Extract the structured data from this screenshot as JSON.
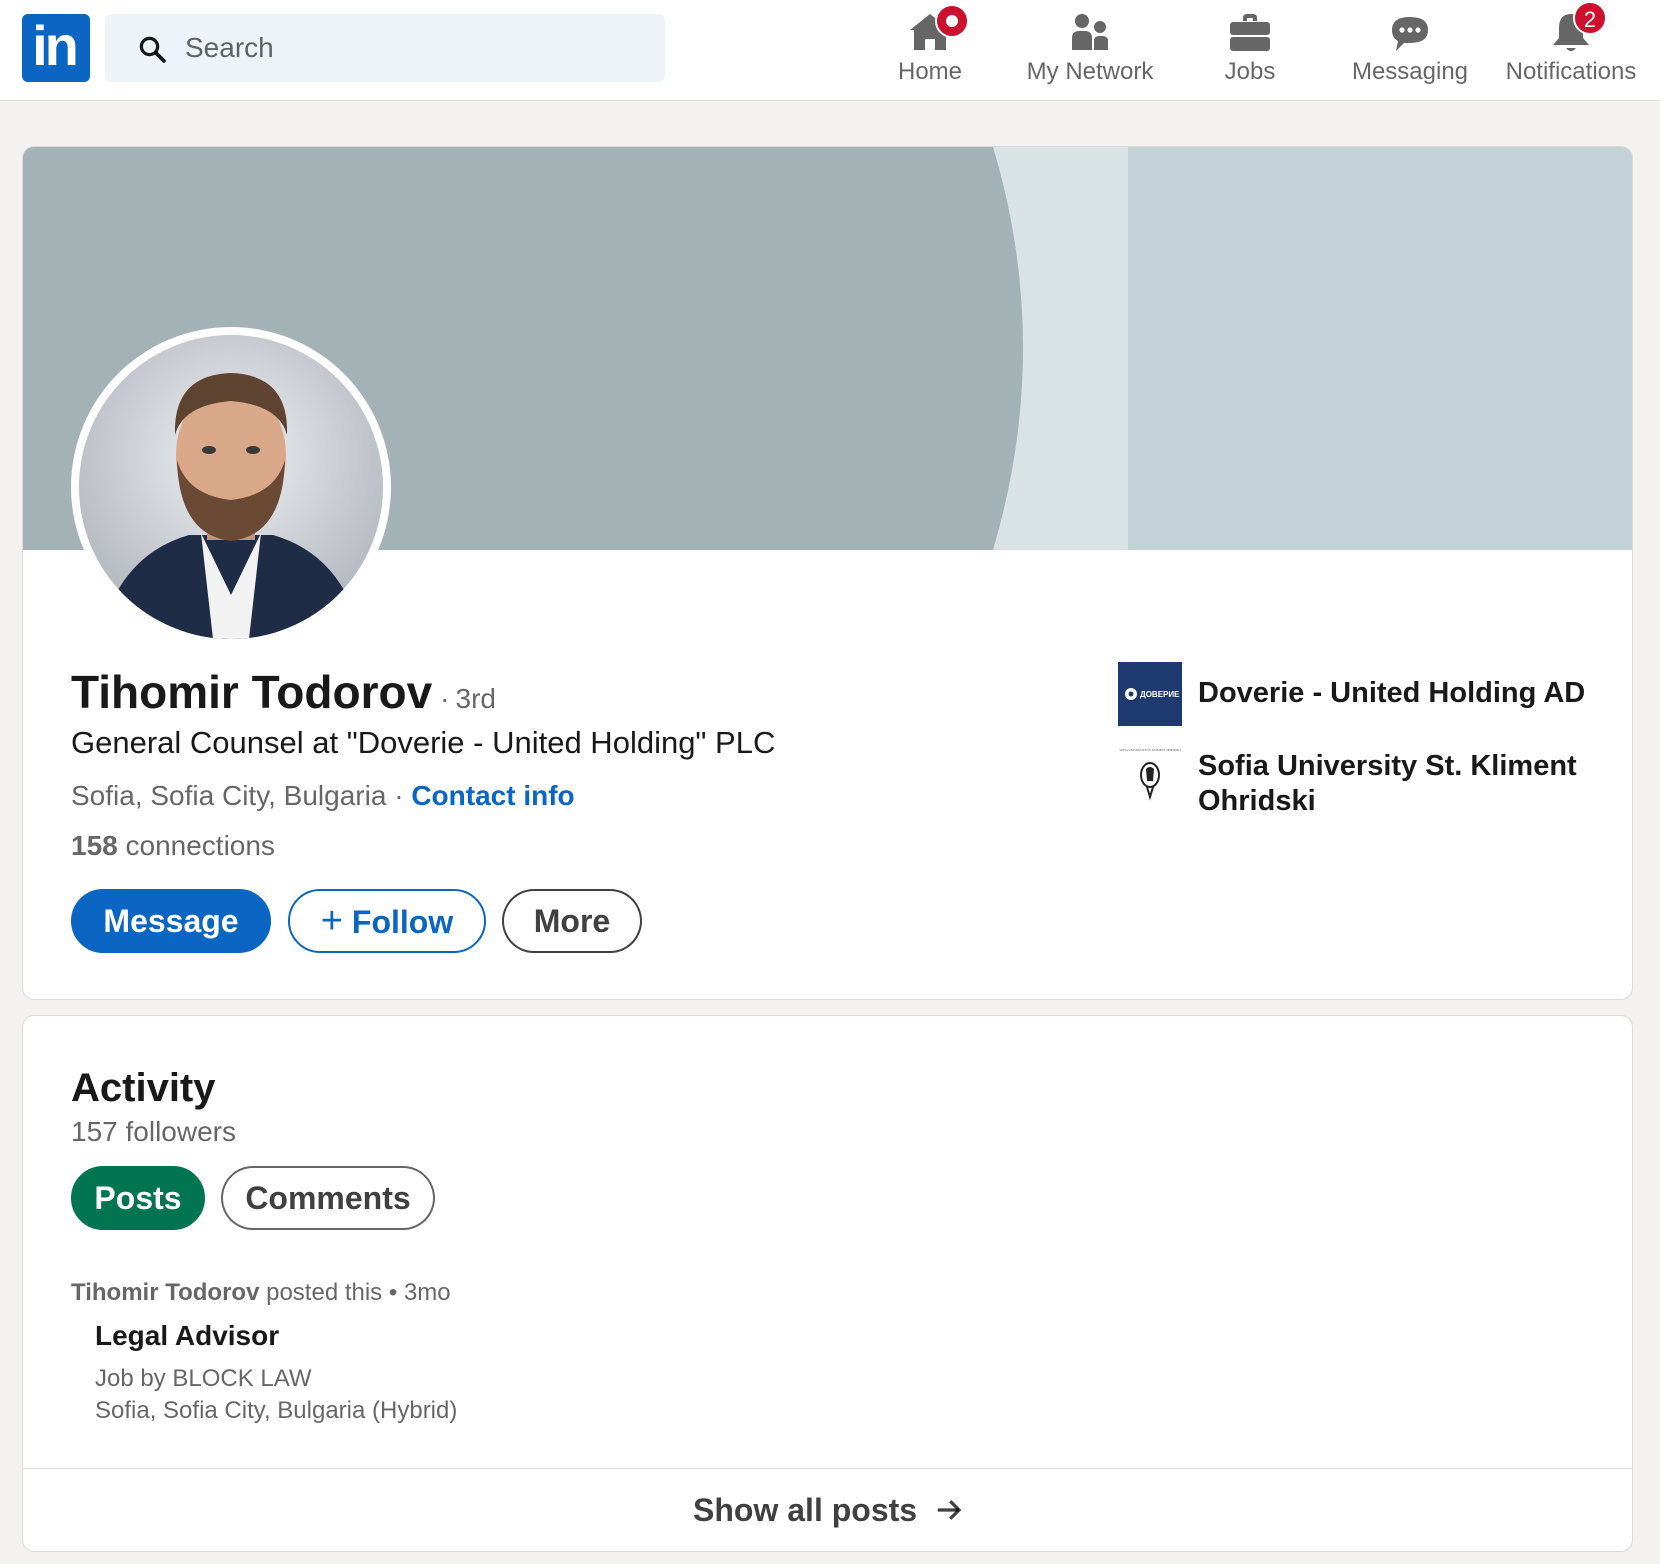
{
  "nav": {
    "logo_text": "in",
    "search_placeholder": "Search",
    "items": [
      {
        "label": "Home",
        "icon": "home-icon",
        "badge": ""
      },
      {
        "label": "My Network",
        "icon": "people-icon",
        "badge": ""
      },
      {
        "label": "Jobs",
        "icon": "briefcase-icon",
        "badge": ""
      },
      {
        "label": "Messaging",
        "icon": "chat-bubble-icon",
        "badge": ""
      },
      {
        "label": "Notifications",
        "icon": "bell-icon",
        "badge": "2"
      }
    ]
  },
  "profile": {
    "name": "Tihomir Todorov",
    "degree_separator": "·",
    "degree": "3rd",
    "headline": "General Counsel at \"Doverie - United Holding\" PLC",
    "location": "Sofia, Sofia City, Bulgaria",
    "location_separator": "·",
    "contact_info": "Contact info",
    "connections_count": "158",
    "connections_label": "connections",
    "buttons": {
      "message": "Message",
      "follow_plus": "+",
      "follow": "Follow",
      "more": "More"
    },
    "orgs": [
      {
        "name": "Doverie - United Holding AD",
        "logo_text": "ДОВЕРИЕ"
      },
      {
        "name": "Sofia University St. Kliment Ohridski",
        "logo_text": "SOFIA UNIVERSITY ST. KLIMENT OHRIDSKI"
      }
    ]
  },
  "activity": {
    "title": "Activity",
    "followers": "157 followers",
    "tabs": {
      "posts": "Posts",
      "comments": "Comments"
    },
    "post": {
      "author": "Tihomir Todorov",
      "action": "posted this",
      "separator": "•",
      "age": "3mo",
      "title": "Legal Advisor",
      "line1": "Job by BLOCK LAW",
      "line2": "Sofia, Sofia City, Bulgaria (Hybrid)"
    },
    "show_all": "Show all posts"
  },
  "colors": {
    "brand": "#0a66c2",
    "posts_pill": "#01754f",
    "badge": "#cb112d",
    "banner_dark": "#a3b2b5",
    "banner_light": "#c3d2d7"
  }
}
